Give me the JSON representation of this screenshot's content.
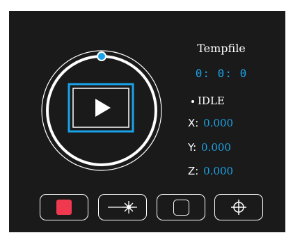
{
  "file": {
    "name": "Tempfile"
  },
  "timer": {
    "text": "0: 0: 0"
  },
  "status": {
    "label": "IDLE"
  },
  "position": {
    "x_label": "X:",
    "x_value": "0.000",
    "y_label": "Y:",
    "y_value": "0.000",
    "z_label": "Z:",
    "z_value": "0.000"
  },
  "controls": {
    "play": {
      "icon": "play-icon"
    },
    "stop": {
      "icon": "stop-icon"
    },
    "laser": {
      "icon": "laser-icon"
    },
    "frame": {
      "icon": "frame-icon"
    },
    "home": {
      "icon": "crosshair-icon"
    }
  },
  "colors": {
    "accent": "#1aa3e8",
    "stop": "#f0394f",
    "background": "#1a1a1a",
    "foreground": "#ffffff"
  }
}
